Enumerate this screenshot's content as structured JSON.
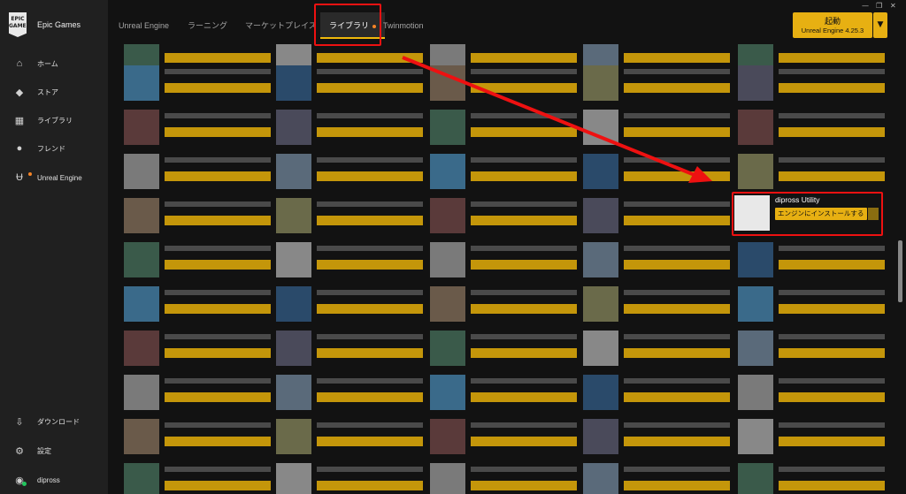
{
  "sidebar": {
    "brand": "Epic Games",
    "logo_text": "EPIC GAMES",
    "items": [
      {
        "label": "ホーム",
        "icon": "home-icon"
      },
      {
        "label": "ストア",
        "icon": "tag-icon"
      },
      {
        "label": "ライブラリ",
        "icon": "grid-icon"
      },
      {
        "label": "フレンド",
        "icon": "friends-icon"
      },
      {
        "label": "Unreal Engine",
        "icon": "unreal-icon"
      }
    ],
    "bottom_items": [
      {
        "label": "ダウンロード",
        "icon": "download-icon"
      },
      {
        "label": "設定",
        "icon": "gear-icon"
      },
      {
        "label": "dipross",
        "icon": "avatar-icon"
      }
    ]
  },
  "tabs": [
    "Unreal Engine",
    "ラーニング",
    "マーケットプレイス",
    "ライブラリ",
    "Twinmotion"
  ],
  "launch": {
    "label": "起動",
    "version": "Unreal Engine 4.25.3"
  },
  "featured": {
    "title": "dipross Utility",
    "button": "エンジンにインストールする"
  },
  "colors": {
    "accent": "#e7b012",
    "highlight": "#ee1111",
    "bg": "#121212",
    "sidebar": "#202020"
  }
}
